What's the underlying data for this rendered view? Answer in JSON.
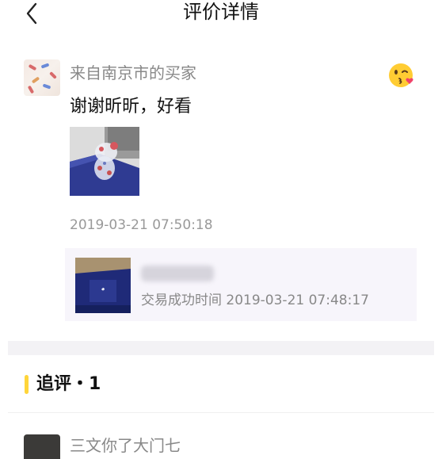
{
  "nav": {
    "title": "评价详情",
    "back_icon": "chevron-left-icon"
  },
  "review": {
    "reviewer": "来自南京市的买家",
    "text": "谢谢昕昕，好看",
    "timestamp": "2019-03-21 07:50:18",
    "emoji_icon": "kissing-face-heart-icon"
  },
  "product": {
    "name": "",
    "trade_info": "交易成功时间 2019-03-21 07:48:17"
  },
  "followup": {
    "title": "追评・1",
    "next_reviewer": "三文你了大门七"
  },
  "colors": {
    "accent": "#ffd53a",
    "card_bg": "#f7f5fb",
    "muted_text": "#888888"
  }
}
